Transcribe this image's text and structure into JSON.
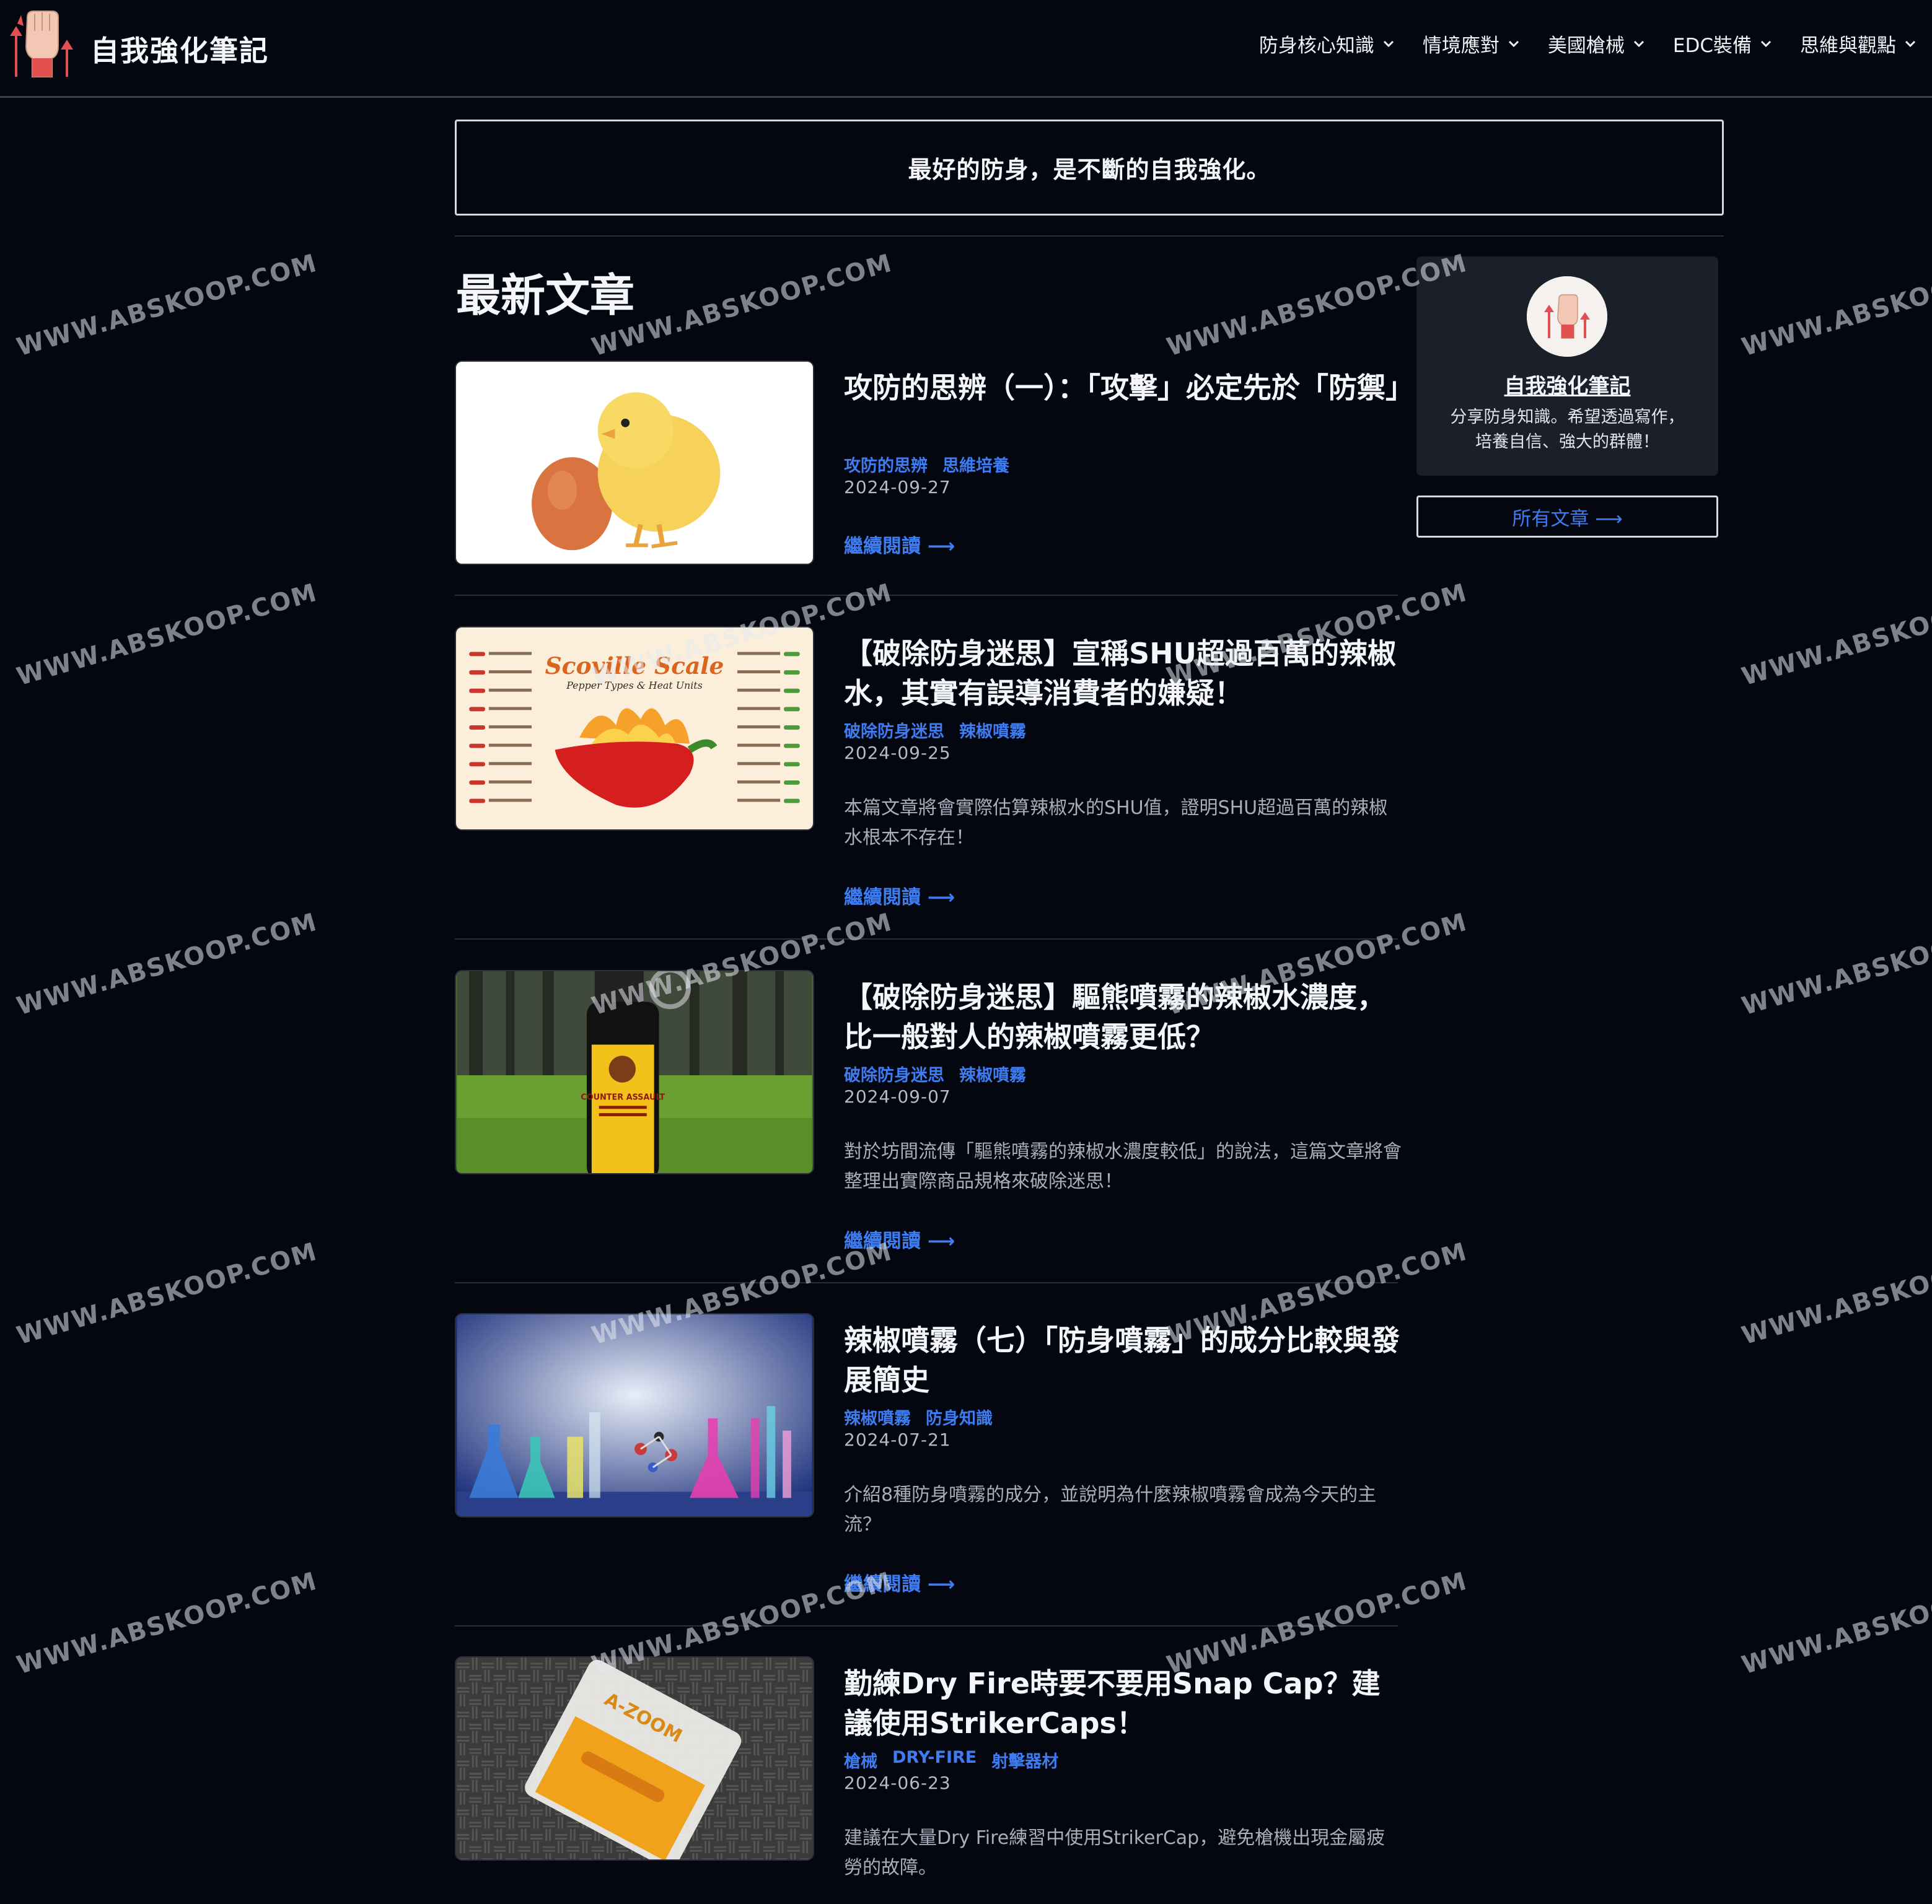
{
  "site": {
    "title": "自我強化筆記"
  },
  "nav": [
    {
      "label": "防身核心知識"
    },
    {
      "label": "情境應對"
    },
    {
      "label": "美國槍械"
    },
    {
      "label": "EDC裝備"
    },
    {
      "label": "思維與觀點"
    }
  ],
  "tagline": "最好的防身，是不斷的自我強化。",
  "section_title": "最新文章",
  "read_more": "繼續閱讀 ⟶",
  "articles": [
    {
      "title": "攻防的思辨（一）：「攻擊」必定先於「防禦」",
      "tags": [
        "攻防的思辨",
        "思維培養"
      ],
      "date": "2024-09-27",
      "excerpt": "",
      "image": "chick-and-egg"
    },
    {
      "title": "【破除防身迷思】宣稱SHU超過百萬的辣椒水，其實有誤導消費者的嫌疑！",
      "tags": [
        "破除防身迷思",
        "辣椒噴霧"
      ],
      "date": "2024-09-25",
      "excerpt": "本篇文章將會實際估算辣椒水的SHU值，證明SHU超過百萬的辣椒水根本不存在！",
      "image": "scoville-scale"
    },
    {
      "title": "【破除防身迷思】驅熊噴霧的辣椒水濃度，比一般對人的辣椒噴霧更低？",
      "tags": [
        "破除防身迷思",
        "辣椒噴霧"
      ],
      "date": "2024-09-07",
      "excerpt": "對於坊間流傳「驅熊噴霧的辣椒水濃度較低」的說法，這篇文章將會整理出實際商品規格來破除迷思！",
      "image": "bear-spray"
    },
    {
      "title": "辣椒噴霧（七）「防身噴霧」的成分比較與發展簡史",
      "tags": [
        "辣椒噴霧",
        "防身知識"
      ],
      "date": "2024-07-21",
      "excerpt": "介紹8種防身噴霧的成分，並說明為什麼辣椒噴霧會成為今天的主流？",
      "image": "chemistry-lab"
    },
    {
      "title": "勤練Dry Fire時要不要用Snap Cap？建議使用StrikerCaps！",
      "tags": [
        "槍械",
        "DRY-FIRE",
        "射擊器材"
      ],
      "date": "2024-06-23",
      "excerpt": "建議在大量Dry Fire練習中使用StrikerCap，避免槍機出現金屬疲勞的故障。",
      "image": "strikercaps"
    }
  ],
  "thumb_text": {
    "scoville_title": "Scoville Scale",
    "scoville_subtitle": "Pepper Types & Heat Units",
    "bear_brand": "COUNTER ASSAULT",
    "striker_brand": "A-ZOOM"
  },
  "sidebar": {
    "name": "自我強化筆記",
    "description": "分享防身知識。希望透過寫作，培養自信、強大的群體！",
    "all_posts": "所有文章 ⟶"
  },
  "watermark": "WWW.ABSKOOP.COM",
  "colors": {
    "background": "#04070f",
    "accent": "#3d7cf2",
    "card": "#1b1f29",
    "logo_red": "#e2504f"
  }
}
